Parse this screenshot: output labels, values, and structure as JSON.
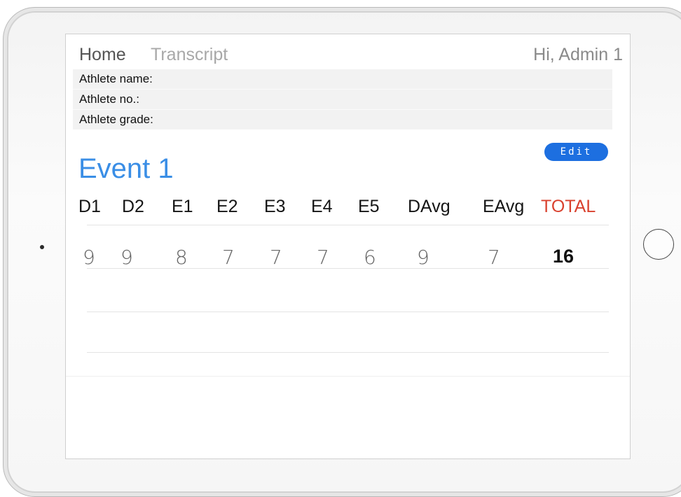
{
  "nav": {
    "home": "Home",
    "transcript": "Transcript",
    "greeting": "Hi, Admin 1"
  },
  "athlete": {
    "name_label": "Athlete name:",
    "number_label": "Athlete no.:",
    "grade_label": "Athlete grade:"
  },
  "event": {
    "title": "Event 1",
    "edit_label": "Edit",
    "headers": [
      "D1",
      "D2",
      "E1",
      "E2",
      "E3",
      "E4",
      "E5",
      "DAvg",
      "EAvg",
      "TOTAL"
    ],
    "scores": [
      "9",
      "9",
      "8",
      "7",
      "7",
      "7",
      "6",
      "9",
      "7",
      "16"
    ]
  },
  "colors": {
    "accent": "#3a8ee6",
    "button": "#1d6fe0",
    "total": "#d9412e"
  }
}
